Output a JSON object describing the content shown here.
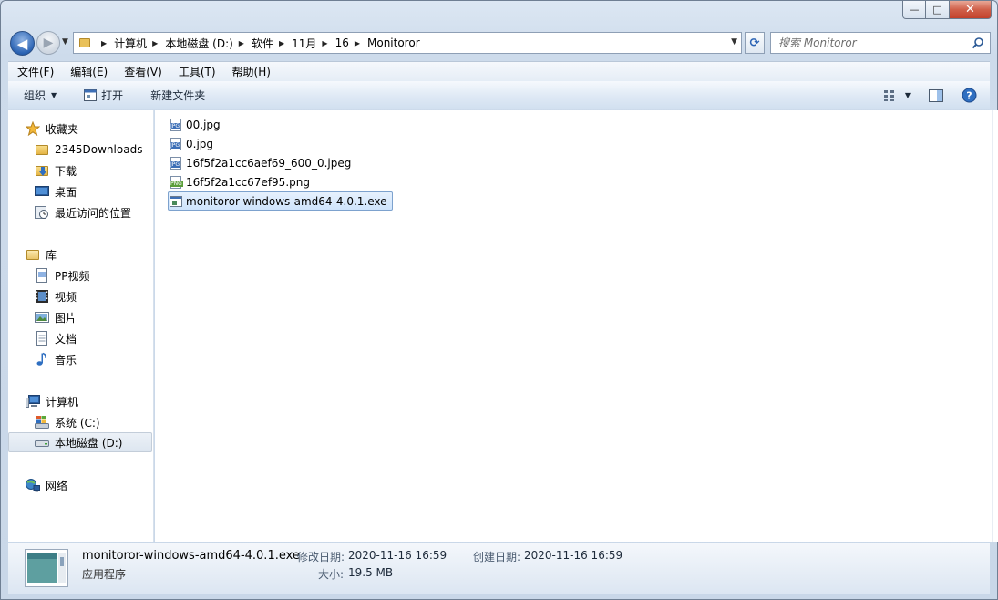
{
  "window": {
    "caption_buttons": {
      "minimize": "—",
      "maximize": "□",
      "close": "✕"
    }
  },
  "nav": {
    "back_glyph": "◀",
    "forward_glyph": "▶",
    "breadcrumbs": [
      "计算机",
      "本地磁盘 (D:)",
      "软件",
      "11月",
      "16",
      "Monitoror"
    ],
    "refresh_glyph": "⟳"
  },
  "search": {
    "placeholder": "搜索 Monitoror"
  },
  "menubar": {
    "items": [
      "文件(F)",
      "编辑(E)",
      "查看(V)",
      "工具(T)",
      "帮助(H)"
    ]
  },
  "toolbar": {
    "organize": "组织",
    "open": "打开",
    "new_folder": "新建文件夹"
  },
  "sidebar": {
    "favorites": {
      "label": "收藏夹",
      "items": [
        "2345Downloads",
        "下载",
        "桌面",
        "最近访问的位置"
      ]
    },
    "libraries": {
      "label": "库",
      "items": [
        "PP视频",
        "视频",
        "图片",
        "文档",
        "音乐"
      ]
    },
    "computer": {
      "label": "计算机",
      "items": [
        "系统 (C:)",
        "本地磁盘 (D:)"
      ]
    },
    "network": {
      "label": "网络"
    }
  },
  "files": [
    {
      "name": "00.jpg",
      "type": "jpg"
    },
    {
      "name": "0.jpg",
      "type": "jpg"
    },
    {
      "name": "16f5f2a1cc6aef69_600_0.jpeg",
      "type": "jpg"
    },
    {
      "name": "16f5f2a1cc67ef95.png",
      "type": "png"
    },
    {
      "name": "monitoror-windows-amd64-4.0.1.exe",
      "type": "exe",
      "selected": true
    }
  ],
  "details": {
    "name": "monitoror-windows-amd64-4.0.1.exe",
    "type": "应用程序",
    "modified_label": "修改日期:",
    "modified_value": "2020-11-16 16:59",
    "created_label": "创建日期:",
    "created_value": "2020-11-16 16:59",
    "size_label": "大小:",
    "size_value": "19.5 MB"
  },
  "colors": {
    "selection_fill": "#cfe4fc",
    "selection_border": "#7da2ce",
    "chrome": "#dce7f3"
  }
}
